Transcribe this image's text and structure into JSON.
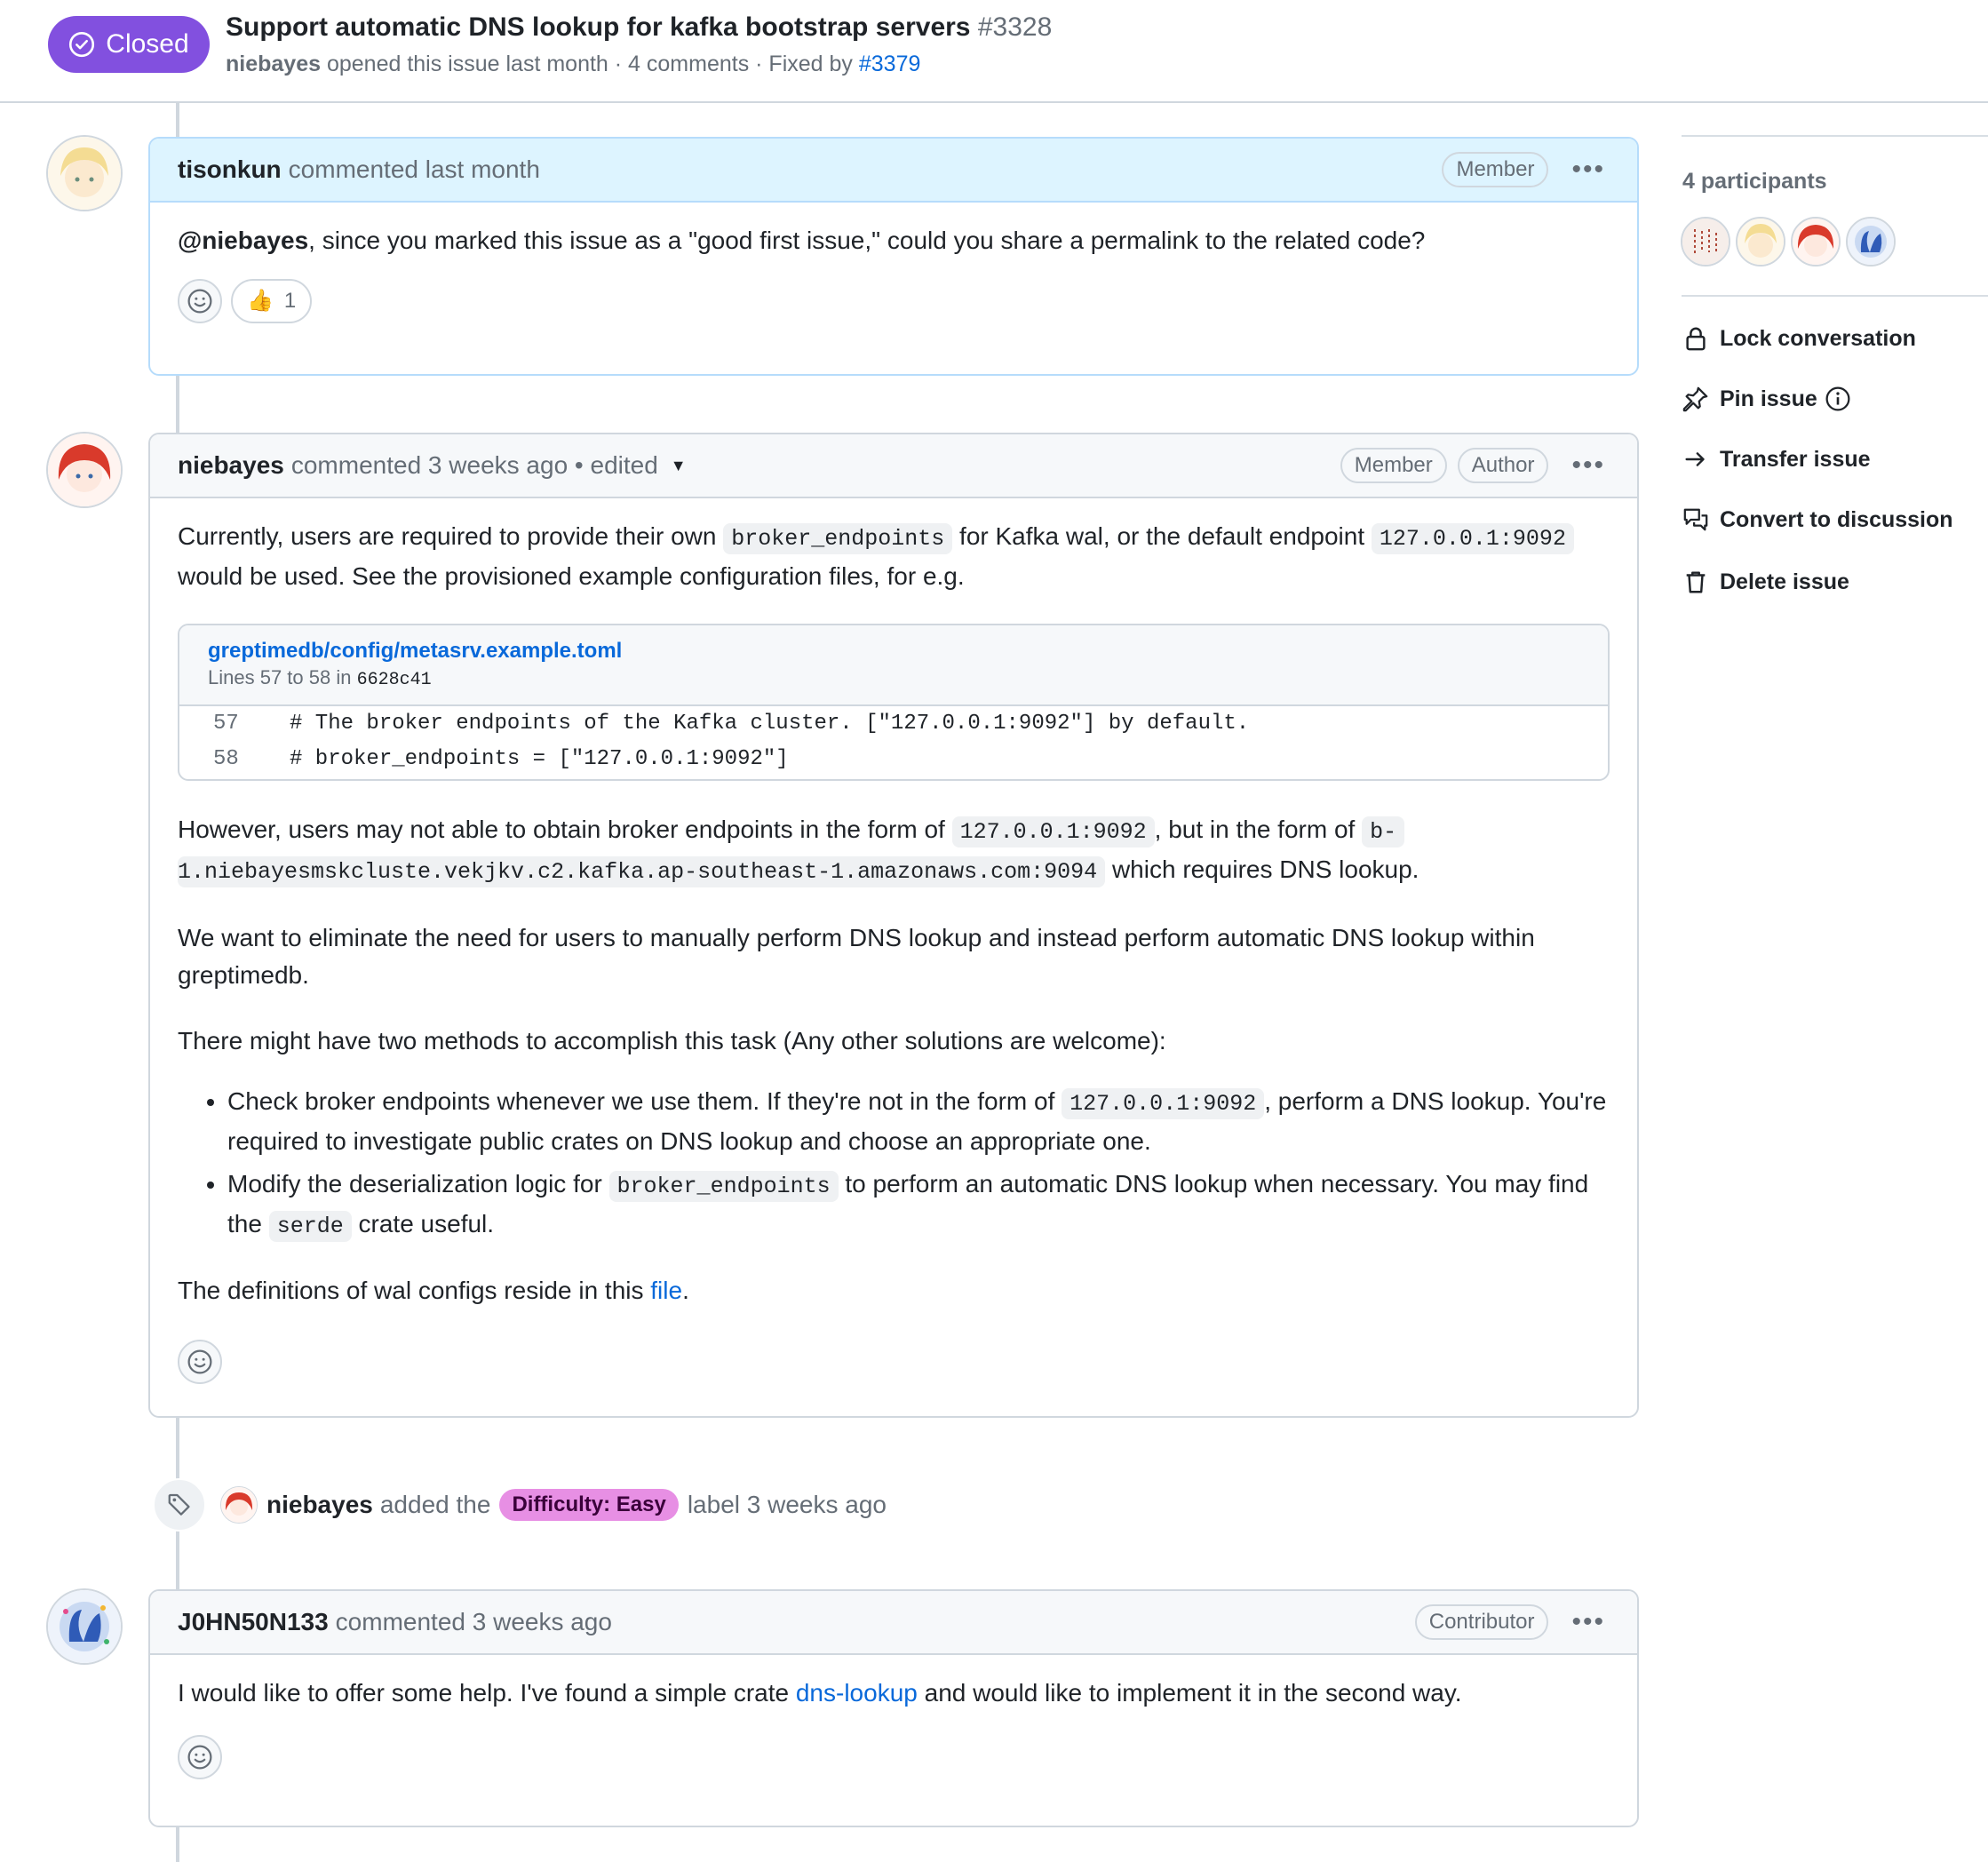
{
  "header": {
    "status": "Closed",
    "title": "Support automatic DNS lookup for kafka bootstrap servers",
    "number": "#3328",
    "author": "niebayes",
    "opened_text": "opened this issue last month · 4 comments · Fixed by",
    "fixed_by": "#3379"
  },
  "comments": [
    {
      "author": "tisonkun",
      "meta": "commented last month",
      "roles": [
        "Member"
      ],
      "mention": "@niebayes",
      "body": ", since you marked this issue as a \"good first issue,\" could you share a permalink to the related code?",
      "reaction_count": "1"
    },
    {
      "author": "niebayes",
      "meta": "commented 3 weeks ago • edited",
      "roles": [
        "Member",
        "Author"
      ],
      "p1_a": "Currently, users are required to provide their own",
      "p1_code1": "broker_endpoints",
      "p1_b": "for Kafka wal, or the default endpoint",
      "p1_code2": "127.0.0.1:9092",
      "p1_c": "would be used. See the provisioned example configuration files, for e.g.",
      "snippet": {
        "path": "greptimedb/config/metasrv.example.toml",
        "lines_label": "Lines 57 to 58 in",
        "commit": "6628c41",
        "rows": [
          {
            "ln": "57",
            "code": "# The broker endpoints of the Kafka cluster. [\"127.0.0.1:9092\"] by default."
          },
          {
            "ln": "58",
            "code": "# broker_endpoints = [\"127.0.0.1:9092\"]"
          }
        ]
      },
      "p2_a": "However, users may not able to obtain broker endpoints in the form of",
      "p2_code1": "127.0.0.1:9092",
      "p2_b": ", but in the form of",
      "p2_code2a": "b-",
      "p2_code2b": "1.niebayesmskcluste.vekjkv.c2.kafka.ap-southeast-1.amazonaws.com:9094",
      "p2_c": "which requires DNS lookup.",
      "p3": "We want to eliminate the need for users to manually perform DNS lookup and instead perform automatic DNS lookup within greptimedb.",
      "p4": "There might have two methods to accomplish this task (Any other solutions are welcome):",
      "li1_a": "Check broker endpoints whenever we use them. If they're not in the form of",
      "li1_code": "127.0.0.1:9092",
      "li1_b": ", perform a DNS lookup. You're required to investigate public crates on DNS lookup and choose an appropriate one.",
      "li2_a": "Modify the deserialization logic for",
      "li2_code": "broker_endpoints",
      "li2_b": "to perform an automatic DNS lookup when necessary. You may find the",
      "li2_code2": "serde",
      "li2_c": "crate useful.",
      "p5_a": "The definitions of wal configs reside in this",
      "p5_link": "file",
      "p5_b": "."
    },
    {
      "author": "J0HN50N133",
      "meta": "commented 3 weeks ago",
      "roles": [
        "Contributor"
      ],
      "body_a": "I would like to offer some help. I've found a simple crate",
      "link": "dns-lookup",
      "body_b": "and would like to implement it in the second way."
    }
  ],
  "label_event": {
    "actor": "niebayes",
    "text_a": "added the",
    "label": "Difficulty: Easy",
    "text_b": "label 3 weeks ago"
  },
  "sidebar": {
    "participants_title": "4 participants",
    "actions": [
      "Lock conversation",
      "Pin issue",
      "Transfer issue",
      "Convert to discussion",
      "Delete issue"
    ]
  },
  "colors": {
    "closed": "#8250df",
    "label": "#e78fe4",
    "link": "#0969da"
  }
}
